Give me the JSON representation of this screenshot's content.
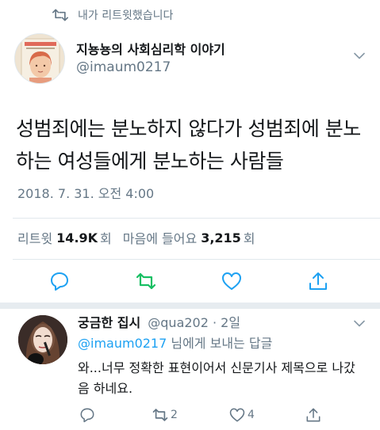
{
  "retweet_context": {
    "label": "내가 리트윗했습니다",
    "icon": "retweet-icon"
  },
  "tweet": {
    "author_name": "지뇽뇽의 사회심리학 이야기",
    "author_handle": "@imaum0217",
    "text": "성범죄에는 분노하지 않다가 성범죄에 분노하는 여성들에게 분노하는 사람들",
    "timestamp": "2018. 7. 31. 오전 4:00",
    "stats": {
      "retweet_label": "리트윗",
      "retweet_count": "14.9K",
      "retweet_unit": "회",
      "like_label": "마음에 들어요",
      "like_count": "3,215",
      "like_unit": "회"
    },
    "actions": [
      "reply-icon",
      "retweet-icon",
      "like-icon",
      "share-icon"
    ]
  },
  "reply": {
    "author_name": "궁금한 집시",
    "meta": "@qua202 · 2일",
    "reply_to_mention": "@imaum0217",
    "reply_to_suffix": " 님에게 보내는 답글",
    "text": "와...너무 정확한 표현이어서 신문기사 제목으로 나갔음 하네요.",
    "retweet_count": "2",
    "like_count": "4"
  },
  "colors": {
    "accent_blue": "#1da1f2",
    "retweet_green": "#17bf63",
    "secondary_text": "#657786",
    "primary_text": "#14171a",
    "divider": "#e1e8ed"
  }
}
